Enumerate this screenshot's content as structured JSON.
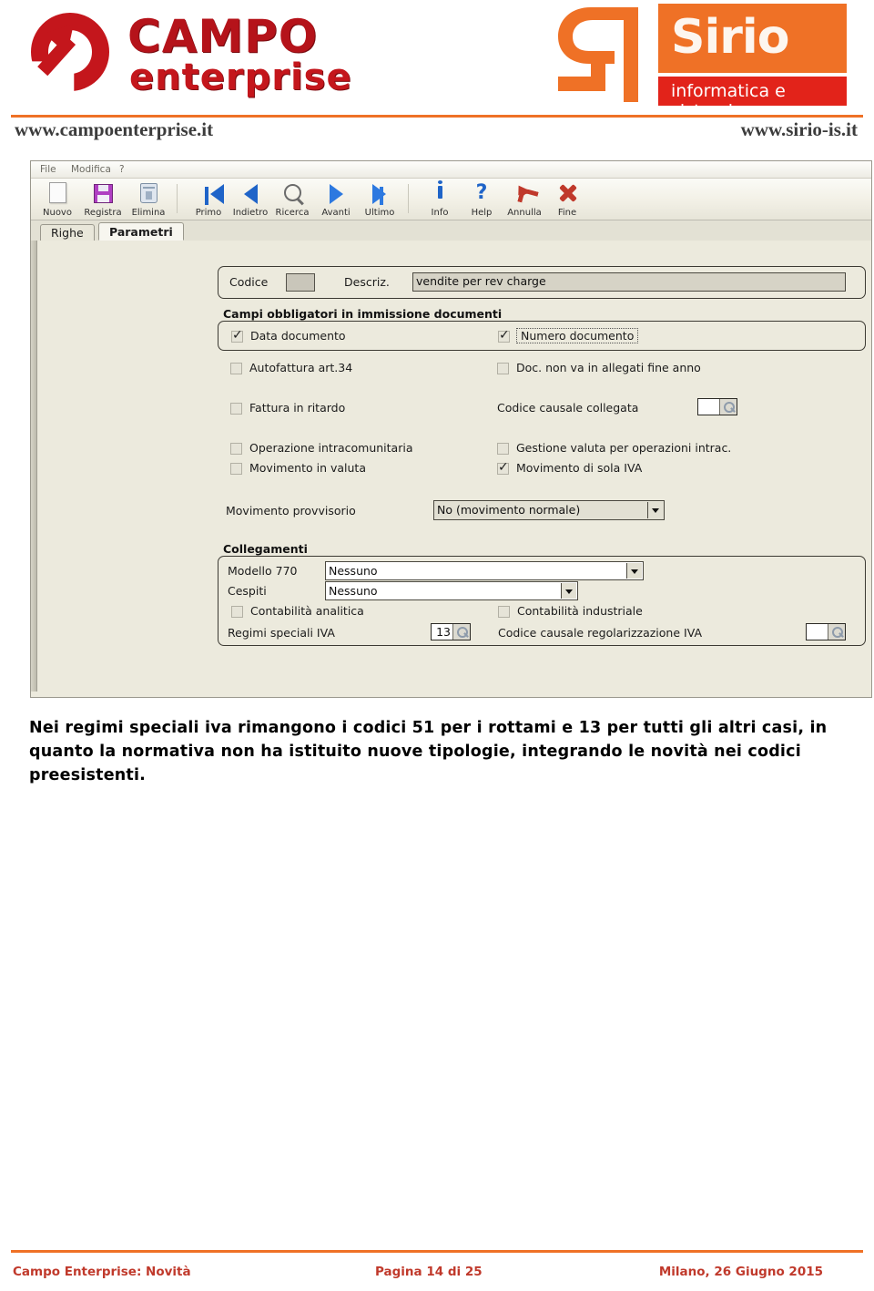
{
  "header": {
    "campo_logo": {
      "line1": "CAMPO",
      "line2": "enterprise",
      "icon": "campo-arrow-circle-logo"
    },
    "sirio_logo": {
      "line1": "Sirio",
      "line2": "informatica e sistemi",
      "icon": "sirio-s-mark"
    },
    "url_left": "www.campoenterprise.it",
    "url_right": "www.sirio-is.it",
    "accent_color": "#ef7126",
    "campo_red": "#c4161c",
    "sirio_red": "#e2231a"
  },
  "app_window": {
    "menubar": [
      "File",
      "Modifica",
      "?"
    ],
    "toolbar": [
      {
        "label": "Nuovo",
        "icon": "new-page-icon"
      },
      {
        "label": "Registra",
        "icon": "floppy-save-icon"
      },
      {
        "label": "Elimina",
        "icon": "trash-delete-icon"
      },
      {
        "label": "Primo",
        "icon": "first-record-icon"
      },
      {
        "label": "Indietro",
        "icon": "previous-record-icon"
      },
      {
        "label": "Ricerca",
        "icon": "magnifier-search-icon"
      },
      {
        "label": "Avanti",
        "icon": "next-record-icon"
      },
      {
        "label": "Ultimo",
        "icon": "last-record-icon"
      },
      {
        "label": "Info",
        "icon": "info-icon"
      },
      {
        "label": "Help",
        "icon": "question-mark-help-icon"
      },
      {
        "label": "Annulla",
        "icon": "undo-arrow-icon"
      },
      {
        "label": "Fine",
        "icon": "red-x-close-icon"
      }
    ],
    "tabs": [
      {
        "label": "Righe",
        "active": false
      },
      {
        "label": "Parametri",
        "active": true
      }
    ],
    "head_row": {
      "codice_label": "Codice",
      "codice_value": "",
      "descriz_label": "Descriz.",
      "descriz_value": "vendite per rev charge"
    },
    "group_campi": {
      "title": "Campi obbligatori in immissione documenti",
      "checkboxes": [
        {
          "label": "Data documento",
          "checked": true,
          "focused": false
        },
        {
          "label": "Numero documento",
          "checked": true,
          "focused": true
        }
      ]
    },
    "group_flags": {
      "rows": [
        {
          "left": {
            "type": "checkbox",
            "label": "Autofattura art.34",
            "checked": false
          },
          "right": {
            "type": "checkbox",
            "label": "Doc. non va in allegati fine anno",
            "checked": false
          }
        },
        {
          "left": {
            "type": "checkbox",
            "label": "Fattura in ritardo",
            "checked": false
          },
          "right": {
            "type": "lookup",
            "label": "Codice causale collegata",
            "value": ""
          }
        },
        {
          "left": {
            "type": "checkbox",
            "label": "Operazione intracomunitaria",
            "checked": false
          },
          "right": {
            "type": "checkbox",
            "label": "Gestione valuta per operazioni intrac.",
            "checked": false
          }
        },
        {
          "left": {
            "type": "checkbox",
            "label": "Movimento in valuta",
            "checked": false
          },
          "right": {
            "type": "checkbox",
            "label": "Movimento di sola IVA",
            "checked": true
          }
        }
      ],
      "movimento_provvisorio": {
        "label": "Movimento provvisorio",
        "value": "No (movimento normale)"
      }
    },
    "group_collegamenti": {
      "title": "Collegamenti",
      "modello_770": {
        "label": "Modello 770",
        "value": "Nessuno"
      },
      "cespiti": {
        "label": "Cespiti",
        "value": "Nessuno"
      },
      "contabilita_analitica": {
        "label": "Contabilità analitica",
        "checked": false
      },
      "contabilita_industriale": {
        "label": "Contabilità industriale",
        "checked": false
      },
      "regimi_speciali_iva": {
        "label": "Regimi speciali IVA",
        "value": "13"
      },
      "codice_causale_regol": {
        "label": "Codice causale regolarizzazione IVA",
        "value": ""
      }
    }
  },
  "body": {
    "paragraph": "Nei regimi speciali iva rimangono i codici 51 per i rottami e 13 per tutti gli altri casi, in quanto la normativa non ha istituito nuove tipologie, integrando le novità nei codici preesistenti."
  },
  "footer": {
    "left": "Campo Enterprise: Novità",
    "center": "Pagina 14 di 25",
    "right": "Milano, 26 Giugno 2015",
    "color": "#c0392b"
  }
}
